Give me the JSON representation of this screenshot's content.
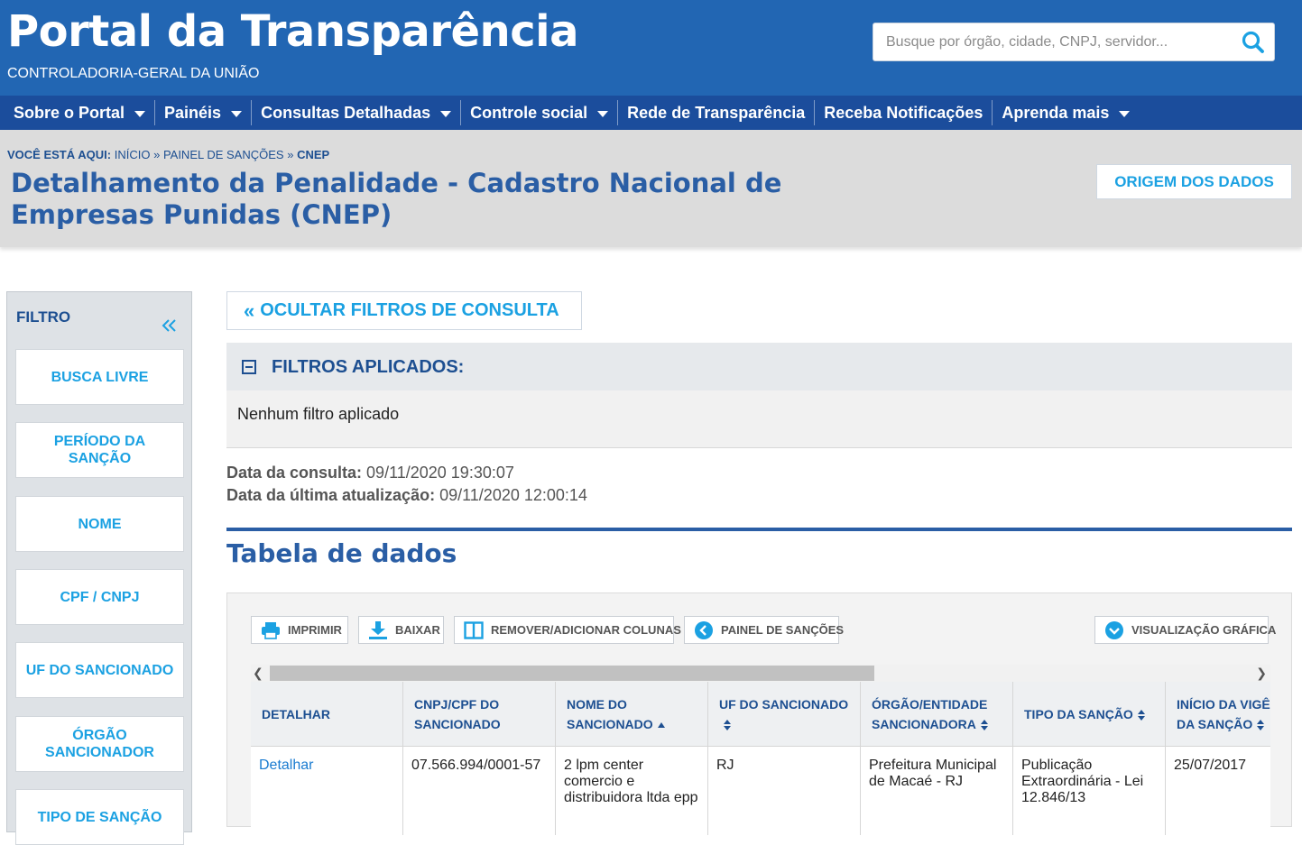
{
  "header": {
    "title": "Portal da Transparência",
    "subtitle": "CONTROLADORIA-GERAL DA UNIÃO",
    "search_placeholder": "Busque por órgão, cidade, CNPJ, servidor..."
  },
  "nav": {
    "items": [
      {
        "label": "Sobre o Portal",
        "dropdown": true
      },
      {
        "label": "Painéis",
        "dropdown": true
      },
      {
        "label": "Consultas Detalhadas",
        "dropdown": true
      },
      {
        "label": "Controle social",
        "dropdown": true
      },
      {
        "label": "Rede de Transparência",
        "dropdown": false
      },
      {
        "label": "Receba Notificações",
        "dropdown": false
      },
      {
        "label": "Aprenda mais",
        "dropdown": true
      }
    ]
  },
  "breadcrumb": {
    "lead": "VOCÊ ESTÁ AQUI:",
    "items": [
      "INÍCIO",
      "PAINEL DE SANÇÕES",
      "CNEP"
    ],
    "sep": "»"
  },
  "page": {
    "title": "Detalhamento da Penalidade - Cadastro Nacional de Empresas Punidas (CNEP)",
    "origem_label": "ORIGEM DOS DADOS"
  },
  "sidebar": {
    "title": "FILTRO",
    "items": [
      "BUSCA LIVRE",
      "PERÍODO DA SANÇÃO",
      "NOME",
      "CPF / CNPJ",
      "UF DO SANCIONADO",
      "ÓRGÃO SANCIONADOR",
      "TIPO DE SANÇÃO"
    ]
  },
  "filters": {
    "toggle_label": "OCULTAR FILTROS DE CONSULTA",
    "applied_title": "FILTROS APLICADOS:",
    "applied_text": "Nenhum filtro aplicado"
  },
  "dates": {
    "consulta_label": "Data da consulta:",
    "consulta_value": "09/11/2020 19:30:07",
    "atualizacao_label": "Data da última atualização:",
    "atualizacao_value": "09/11/2020 12:00:14"
  },
  "table": {
    "title": "Tabela de dados",
    "toolbar": {
      "print": "IMPRIMIR",
      "download": "BAIXAR",
      "columns": "REMOVER/ADICIONAR COLUNAS",
      "panel": "PAINEL DE SANÇÕES",
      "chart": "VISUALIZAÇÃO GRÁFICA"
    },
    "columns": [
      "DETALHAR",
      "CNPJ/CPF DO SANCIONADO",
      "NOME DO SANCIONADO",
      "UF DO SANCIONADO",
      "ÓRGÃO/ENTIDADE SANCIONADORA",
      "TIPO DA SANÇÃO",
      "INÍCIO DA VIGÊNCIA DA SANÇÃO"
    ],
    "rows": [
      [
        "Detalhar",
        "07.566.994/0001-57",
        "2 lpm center comercio e distribuidora ltda epp",
        "RJ",
        "Prefeitura Municipal de Macaé - RJ",
        "Publicação Extraordinária - Lei 12.846/13",
        "25/07/2017"
      ]
    ]
  },
  "colors": {
    "header_bg": "#2266b3",
    "nav_bg": "#1b4d9c",
    "accent": "#1ba1e2",
    "title_blue": "#2a5ea5"
  }
}
